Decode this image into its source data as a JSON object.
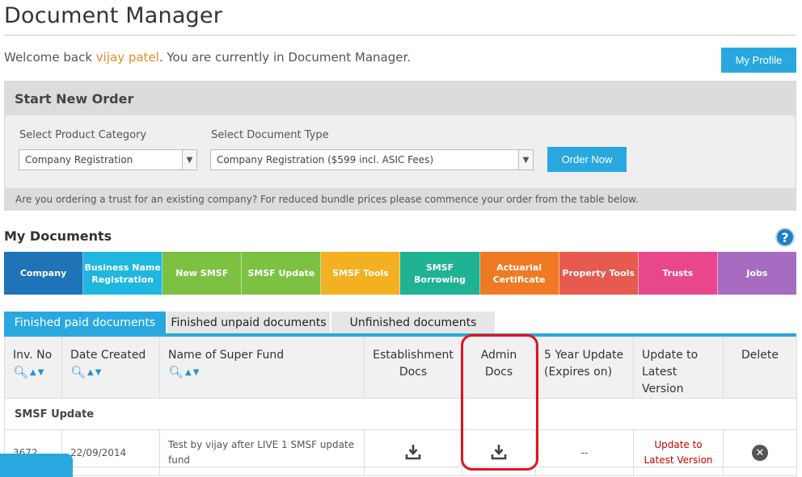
{
  "page": {
    "title": "Document Manager"
  },
  "welcome": {
    "prefix": "Welcome back ",
    "user": "vijay patel",
    "suffix": ". You are currently in Document Manager."
  },
  "profile_button": "My Profile",
  "order": {
    "header": "Start New Order",
    "category_label": "Select Product Category",
    "category_value": "Company Registration",
    "doctype_label": "Select Document Type",
    "doctype_value": "Company Registration ($599 incl. ASIC Fees)",
    "order_button": "Order Now",
    "trust_note": "Are you ordering a trust for an existing company? For reduced bundle prices please commence your order from the table below."
  },
  "my_documents": {
    "title": "My Documents",
    "help": "?"
  },
  "categories": [
    {
      "label": "Company",
      "color": "#1f73b7"
    },
    {
      "label": "Business Name Registration",
      "color": "#1fb7e0"
    },
    {
      "label": "New SMSF",
      "color": "#7cc142"
    },
    {
      "label": "SMSF Update",
      "color": "#7cc142"
    },
    {
      "label": "SMSF Tools",
      "color": "#f3b020"
    },
    {
      "label": "SMSF Borrowing",
      "color": "#1fb393"
    },
    {
      "label": "Actuarial Certificate",
      "color": "#f07a24"
    },
    {
      "label": "Property Tools",
      "color": "#e75a4f"
    },
    {
      "label": "Trusts",
      "color": "#e8478c"
    },
    {
      "label": "Jobs",
      "color": "#a56cc1"
    }
  ],
  "doc_tabs": {
    "finished_paid": "Finished paid documents",
    "finished_unpaid": "Finished unpaid documents",
    "unfinished": "Unfinished documents"
  },
  "table": {
    "headers": {
      "inv_no": "Inv. No",
      "date_created": "Date Created",
      "fund_name": "Name of Super Fund",
      "establishment_docs": "Establishment Docs",
      "admin_docs": "Admin Docs",
      "five_year": "5 Year Update (Expires on)",
      "update_latest": "Update to Latest Version",
      "delete": "Delete"
    },
    "group": "SMSF Update",
    "rows": [
      {
        "inv_no": "3672",
        "date": "22/09/2014",
        "fund": "Test by vijay after LIVE 1 SMSF update fund",
        "five_year": "--",
        "update_link": "Update to Latest Version"
      }
    ]
  },
  "icons": {
    "search": "magnifier-icon",
    "sort_up": "triangle-up-icon",
    "sort_down": "triangle-down-icon",
    "download": "download-icon",
    "delete": "close-circle-icon",
    "help": "question-icon"
  }
}
